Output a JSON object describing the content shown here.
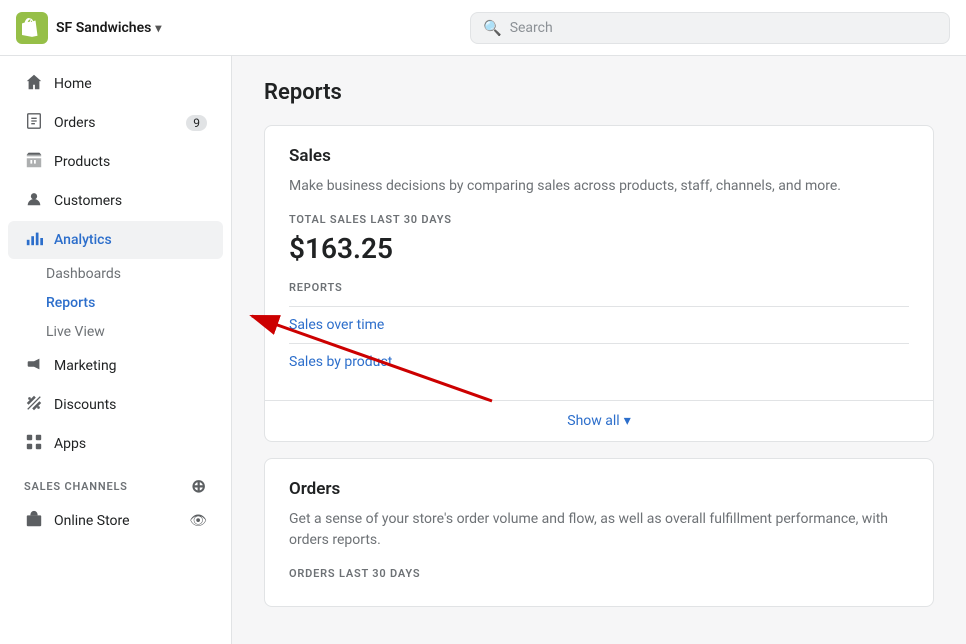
{
  "topbar": {
    "store_name": "SF Sandwiches",
    "chevron": "▾",
    "search_placeholder": "Search"
  },
  "sidebar": {
    "nav_items": [
      {
        "id": "home",
        "label": "Home",
        "icon": "⌂",
        "badge": null
      },
      {
        "id": "orders",
        "label": "Orders",
        "icon": "↓□",
        "badge": "9"
      },
      {
        "id": "products",
        "label": "Products",
        "icon": "🏷",
        "badge": null
      },
      {
        "id": "customers",
        "label": "Customers",
        "icon": "👤",
        "badge": null
      },
      {
        "id": "analytics",
        "label": "Analytics",
        "icon": "📊",
        "badge": null
      }
    ],
    "analytics_sub": [
      {
        "id": "dashboards",
        "label": "Dashboards",
        "active": false
      },
      {
        "id": "reports",
        "label": "Reports",
        "active": true
      },
      {
        "id": "live-view",
        "label": "Live View",
        "active": false
      }
    ],
    "more_items": [
      {
        "id": "marketing",
        "label": "Marketing",
        "icon": "📢"
      },
      {
        "id": "discounts",
        "label": "Discounts",
        "icon": "🏷"
      },
      {
        "id": "apps",
        "label": "Apps",
        "icon": "⊞"
      }
    ],
    "sales_channels_label": "SALES CHANNELS",
    "sales_channels": [
      {
        "id": "online-store",
        "label": "Online Store",
        "icon": "🏪"
      }
    ]
  },
  "content": {
    "page_title": "Reports",
    "sales_card": {
      "title": "Sales",
      "description": "Make business decisions by comparing sales across products, staff, channels, and more.",
      "metric_label": "TOTAL SALES LAST 30 DAYS",
      "metric_value": "$163.25",
      "reports_label": "REPORTS",
      "links": [
        {
          "id": "sales-over-time",
          "label": "Sales over time"
        },
        {
          "id": "sales-by-product",
          "label": "Sales by product"
        }
      ],
      "show_all_label": "Show all",
      "chevron": "▾"
    },
    "orders_card": {
      "title": "Orders",
      "description": "Get a sense of your store's order volume and flow, as well as overall fulfillment performance, with orders reports.",
      "metric_label": "ORDERS LAST 30 DAYS"
    }
  }
}
